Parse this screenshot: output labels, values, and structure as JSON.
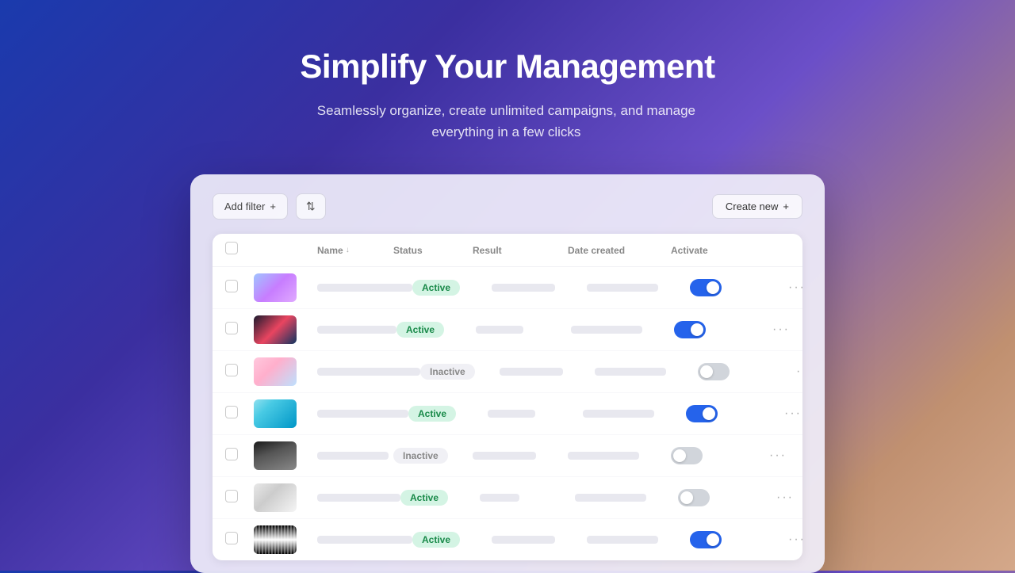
{
  "hero": {
    "title": "Simplify Your Management",
    "subtitle": "Seamlessly organize, create unlimited campaigns, and manage everything in a few clicks"
  },
  "toolbar": {
    "add_filter_label": "Add filter",
    "add_filter_icon": "+",
    "sort_icon": "⇅",
    "create_new_label": "Create new",
    "create_new_icon": "+"
  },
  "table": {
    "headers": {
      "name": "Name",
      "status": "Status",
      "result": "Result",
      "date_created": "Date created",
      "activate": "Activate"
    },
    "rows": [
      {
        "id": 1,
        "thumb": "1",
        "status": "Active",
        "toggle": true
      },
      {
        "id": 2,
        "thumb": "2",
        "status": "Active",
        "toggle": true
      },
      {
        "id": 3,
        "thumb": "3",
        "status": "Inactive",
        "toggle": false
      },
      {
        "id": 4,
        "thumb": "4",
        "status": "Active",
        "toggle": true
      },
      {
        "id": 5,
        "thumb": "5",
        "status": "Inactive",
        "toggle": false
      },
      {
        "id": 6,
        "thumb": "6",
        "status": "Active",
        "toggle": false
      },
      {
        "id": 7,
        "thumb": "7",
        "status": "Active",
        "toggle": true
      }
    ]
  }
}
